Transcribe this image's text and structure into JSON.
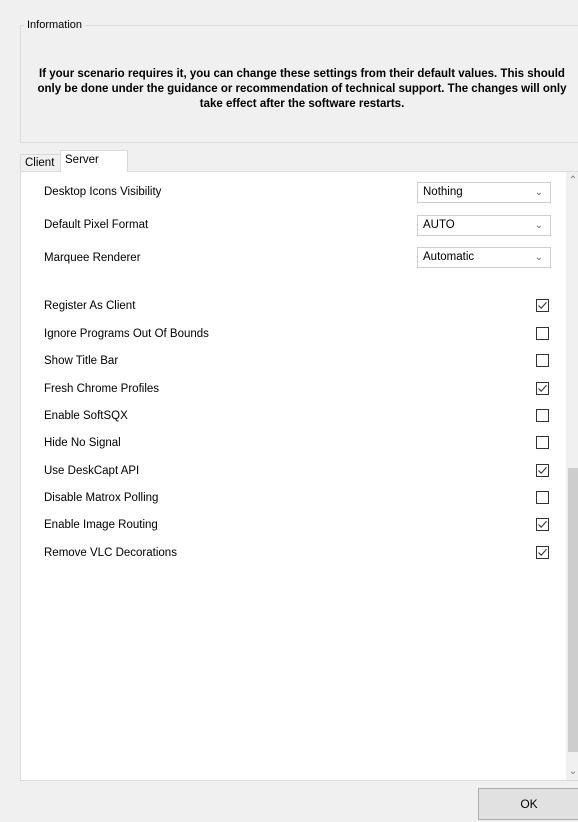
{
  "info": {
    "group_label": "Information",
    "message": "If your scenario requires it, you can change these settings from their default values. This should only be done under the guidance or recommendation of technical support. The changes will only take effect after the software restarts."
  },
  "tabs": [
    {
      "label": "Client",
      "active": false
    },
    {
      "label": "Server",
      "active": true
    }
  ],
  "dropdowns": [
    {
      "label": "Desktop Icons Visibility",
      "value": "Nothing"
    },
    {
      "label": "Default Pixel Format",
      "value": "AUTO"
    },
    {
      "label": "Marquee Renderer",
      "value": "Automatic"
    }
  ],
  "checkboxes": [
    {
      "label": "Register As Client",
      "checked": true
    },
    {
      "label": "Ignore Programs Out Of Bounds",
      "checked": false
    },
    {
      "label": "Show Title Bar",
      "checked": false
    },
    {
      "label": "Fresh Chrome Profiles",
      "checked": true
    },
    {
      "label": "Enable SoftSQX",
      "checked": false
    },
    {
      "label": "Hide No Signal",
      "checked": false
    },
    {
      "label": "Use DeskCapt API",
      "checked": true
    },
    {
      "label": "Disable Matrox Polling",
      "checked": false
    },
    {
      "label": "Enable Image Routing",
      "checked": true
    },
    {
      "label": "Remove VLC Decorations",
      "checked": true
    }
  ],
  "footer": {
    "ok_label": "OK"
  }
}
